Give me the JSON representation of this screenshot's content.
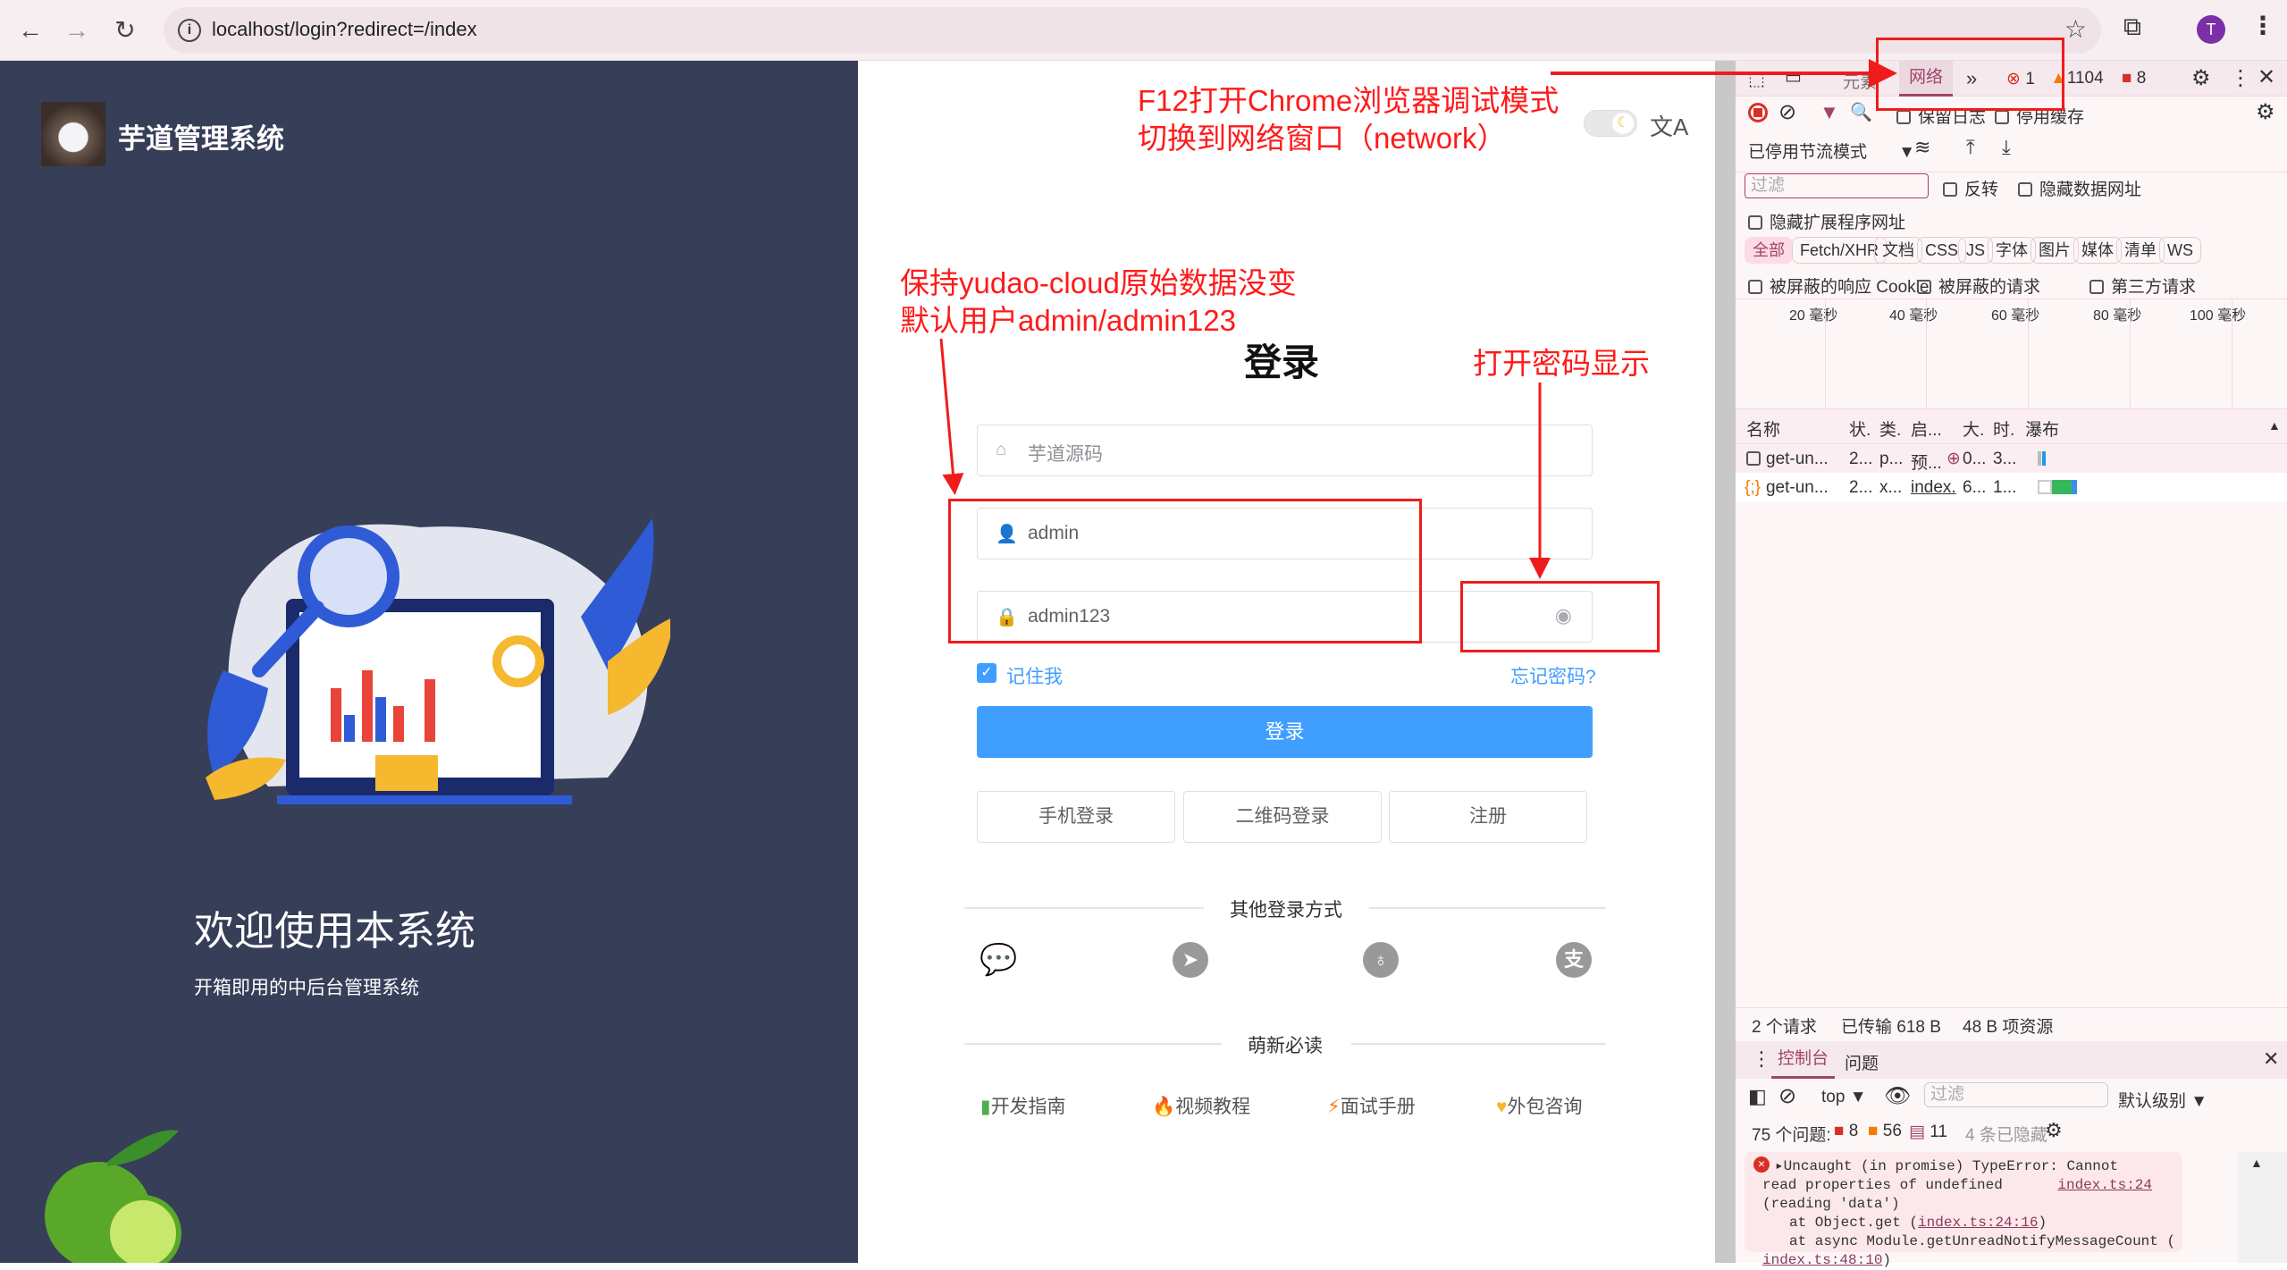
{
  "browser": {
    "url": "localhost/login?redirect=/index",
    "profile_initial": "T",
    "back_icon": "arrow-left",
    "forward_icon": "arrow-right",
    "reload_icon": "reload"
  },
  "left_panel": {
    "app_title": "芋道管理系统",
    "welcome_title": "欢迎使用本系统",
    "welcome_subtitle": "开箱即用的中后台管理系统",
    "background": "#373e58"
  },
  "login": {
    "title": "登录",
    "tenant_placeholder": "芋道源码",
    "username": "admin",
    "password": "admin123",
    "remember_me": "记住我",
    "remember_checked": true,
    "forgot_password": "忘记密码?",
    "submit": "登录",
    "alt_buttons": [
      "手机登录",
      "二维码登录",
      "注册"
    ],
    "other_login_label": "其他登录方式",
    "social_icons": [
      "wechat-icon",
      "dingtalk-icon",
      "github-icon",
      "alipay-icon"
    ],
    "newbie_label": "萌新必读",
    "links": [
      "开发指南",
      "视频教程",
      "面试手册",
      "外包咨询"
    ],
    "accent": "#409eff"
  },
  "annotations": {
    "f12_line1": "F12打开Chrome浏览器调试模式",
    "f12_line2": "切换到网络窗口（network）",
    "data_line1": "保持yudao-cloud原始数据没变",
    "data_line2": "默认用户admin/admin123",
    "password_note": "打开密码显示",
    "color": "#f01c1c"
  },
  "devtools": {
    "tab_prev": "元素",
    "tab_active": "网络",
    "errors": "1",
    "warnings": "1104",
    "issues": "8",
    "preserve_log": "保留日志",
    "disable_cache": "停用缓存",
    "throttle": "已停用节流模式",
    "filter_placeholder": "过滤",
    "invert": "反转",
    "hide_data_urls": "隐藏数据网址",
    "hide_ext_urls": "隐藏扩展程序网址",
    "types": [
      "全部",
      "Fetch/XHR",
      "文档",
      "CSS",
      "JS",
      "字体",
      "图片",
      "媒体",
      "清单",
      "WS"
    ],
    "blocked_cookies": "被屏蔽的响应 Cookie",
    "blocked_requests": "被屏蔽的请求",
    "third_party": "第三方请求",
    "timeline_ticks": [
      "20 毫秒",
      "40 毫秒",
      "60 毫秒",
      "80 毫秒",
      "100 毫秒"
    ],
    "columns": [
      "名称",
      "状.",
      "类.",
      "启...",
      "大.",
      "时.",
      "瀑布"
    ],
    "rows": [
      {
        "name": "get-un...",
        "status": "2...",
        "type": "p...",
        "initiator": "预...",
        "size": "0...",
        "time": "3..."
      },
      {
        "name": "get-un...",
        "status": "2...",
        "type": "x...",
        "initiator": "index.",
        "size": "6...",
        "time": "1..."
      }
    ],
    "summary": [
      "2 个请求",
      "已传输 618 B",
      "48 B 项资源"
    ],
    "drawer_tabs": [
      "控制台",
      "问题"
    ],
    "context": "top",
    "console_filter_placeholder": "过滤",
    "level": "默认级别",
    "issues_label": "75 个问题:",
    "issue_counts": [
      "8",
      "56",
      "11"
    ],
    "hidden": "4 条已隐藏",
    "error_line1": "Uncaught (in promise) TypeError: Cannot",
    "error_source": "index.ts:24",
    "error_line2": "read properties of undefined (reading 'data')",
    "error_at1_prefix": "at Object.get (",
    "error_at1_link": "index.ts:24:16",
    "error_at2": "at async Module.getUnreadNotifyMessageCount (",
    "error_at2_link": "index.ts:48:10",
    "accent": "#a0446a"
  }
}
